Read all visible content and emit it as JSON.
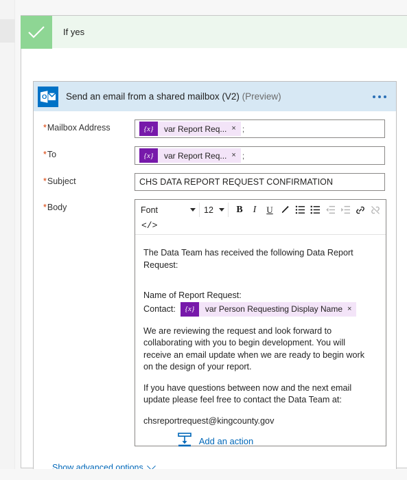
{
  "branch": {
    "label": "If yes",
    "check_icon": "checkmark-icon",
    "header_bg": "#edf7ee",
    "check_bg": "#8ed694"
  },
  "action_card": {
    "icon": "outlook-icon",
    "title": "Send an email from a shared mailbox (V2)",
    "preview_tag": "(Preview)",
    "menu_icon": "ellipsis-icon",
    "header_bg": "#d7e8f4",
    "fields": [
      {
        "label": "Mailbox Address",
        "required_mark": "*",
        "token": {
          "badge": "{x}",
          "text": "var Report Req...",
          "close": "×"
        },
        "trailing": ";"
      },
      {
        "label": "To",
        "required_mark": "*",
        "token": {
          "badge": "{x}",
          "text": "var Report Req...",
          "close": "×"
        },
        "trailing": ";"
      },
      {
        "label": "Subject",
        "required_mark": "*",
        "value": "CHS DATA REPORT REQUEST CONFIRMATION"
      },
      {
        "label": "Body",
        "required_mark": "*"
      }
    ]
  },
  "editor": {
    "toolbar": {
      "font_label": "Font",
      "size_label": "12",
      "bold": "B",
      "italic": "I",
      "underline": "U",
      "text_color_icon": "pen-icon",
      "bulleted_list_icon": "bulleted-list-icon",
      "numbered_list_icon": "numbered-list-icon",
      "decrease_indent_icon": "decrease-indent-icon",
      "increase_indent_icon": "increase-indent-icon",
      "link_icon": "link-icon",
      "unlink_icon": "unlink-icon",
      "code_view": "</>"
    },
    "body": {
      "p1": "The Data Team has received the following Data Report Request:",
      "p2": "Name of Report Request:",
      "contact_label": "Contact:",
      "contact_token": {
        "badge": "{x}",
        "text": "var Person Requesting Display Name",
        "close": "×"
      },
      "p3": "We are reviewing the request and look forward to collaborating with you to begin development.  You will receive an email update when we are ready to begin work on the design of your report.",
      "p4": "If you have questions between now and the next email update please feel free to contact the Data Team at:",
      "p5": "chsreportrequest@kingcounty.gov"
    }
  },
  "advanced": {
    "label": "Show advanced options",
    "chevron_icon": "chevron-down-icon"
  },
  "add_action": {
    "label": "Add an action",
    "icon": "insert-below-icon",
    "color": "#0067b8"
  },
  "colors": {
    "accent_link": "#0067b8",
    "token_badge": "#7719aa",
    "token_pill": "#f3e4f8",
    "required": "#d83b01",
    "outlook_blue": "#0072c6"
  }
}
